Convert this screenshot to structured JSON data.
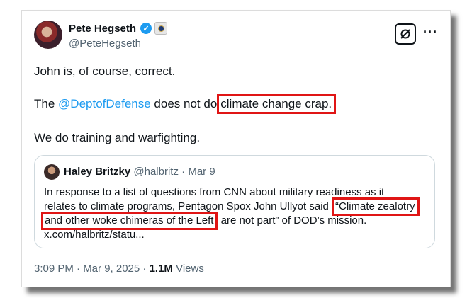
{
  "author": {
    "name": "Pete Hegseth",
    "handle": "@PeteHegseth",
    "verified_icon": "verified-check-icon",
    "affiliate_icon": "government-affiliate-badge-icon"
  },
  "toolbar": {
    "grok_icon": "grok-icon",
    "more_label": "···"
  },
  "tweet": {
    "line1": "John is, of course, correct.",
    "line2_pre": "The ",
    "line2_mention": "@DeptofDefense",
    "line2_mid": " does not do",
    "line2_highlight": "climate change crap.",
    "line3": "We do training and warfighting."
  },
  "quote": {
    "name": "Haley Britzky",
    "handle": "@halbritz",
    "separator": " · ",
    "date": "Mar 9",
    "line1": "In response to a list of questions from CNN about military readiness as it",
    "line2_pre": "relates to climate programs, Pentagon Spox John Ullyot said ",
    "line2_highlight": "“Climate zealotry",
    "line3_highlight": "and other woke chimeras of the Left",
    "line3_post": " are not part” of DOD’s mission.",
    "line4": "x.com/halbritz/statu..."
  },
  "footer": {
    "time": "3:09 PM · Mar 9, 2025 · ",
    "views_count": "1.1M",
    "views_label": " Views"
  },
  "colors": {
    "highlight_box": "#e01515",
    "link": "#1d9bf0",
    "text": "#0f1419",
    "muted": "#536471"
  }
}
